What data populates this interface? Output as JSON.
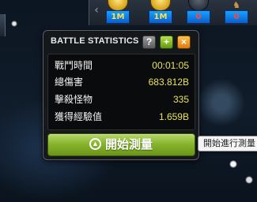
{
  "item_bar": {
    "arrow": "‹",
    "slots": [
      {
        "name": "gold-coin-1",
        "count": "1M",
        "count_color": "yellow"
      },
      {
        "name": "gold-coin-2",
        "count": "1M",
        "count_color": "yellow"
      },
      {
        "name": "dark-coin",
        "count": "0",
        "count_color": "red"
      },
      {
        "name": "warrior-item",
        "count": "0",
        "count_color": "red"
      }
    ]
  },
  "panel": {
    "title": "BATTLE STATISTICS",
    "help_label": "?",
    "add_label": "+",
    "close_label": "×",
    "stats": [
      {
        "label": "戰鬥時間",
        "value": "00:01:05"
      },
      {
        "label": "總傷害",
        "value": "683.812B"
      },
      {
        "label": "擊殺怪物",
        "value": "335"
      },
      {
        "label": "獲得經驗值",
        "value": "1.659B"
      }
    ],
    "start_button_label": "開始測量"
  },
  "tooltip": {
    "text": "開始進行測量"
  },
  "colors": {
    "value_yellow": "#e9e35a",
    "button_green": "#88b52e",
    "add_green": "#5f9a10",
    "close_orange": "#e07a10"
  }
}
